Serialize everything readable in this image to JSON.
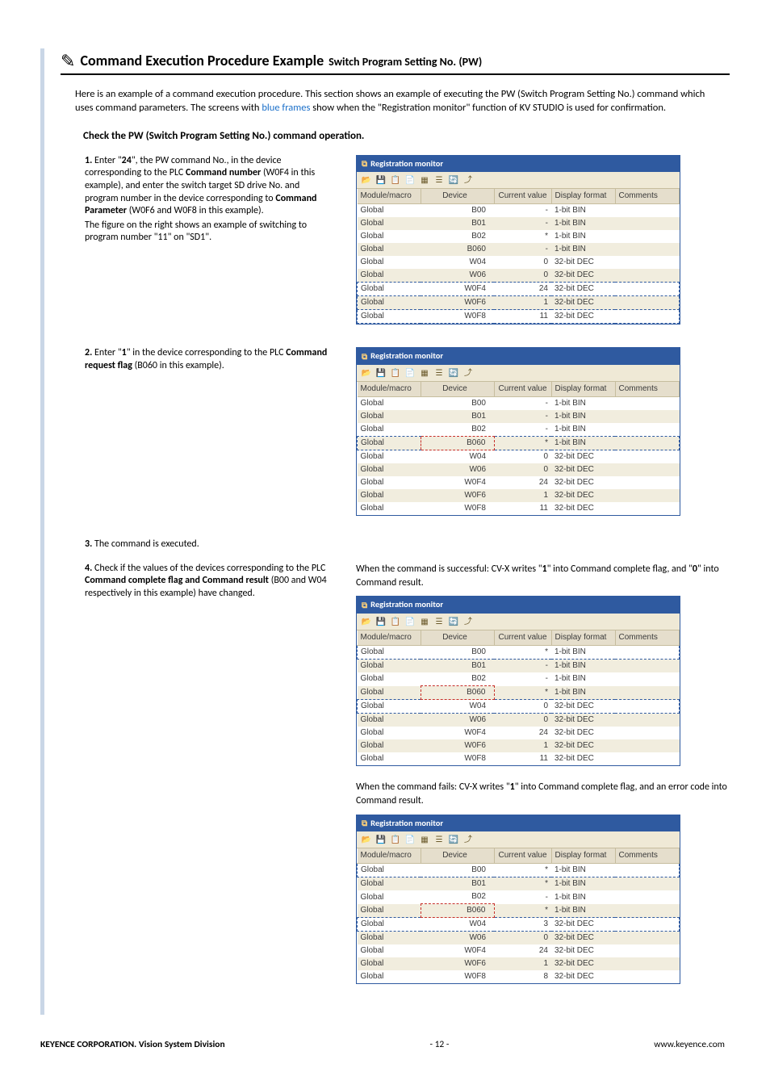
{
  "header": {
    "title_main": "Command Execution Procedure Example",
    "title_sub": "Switch Program Setting No. (PW)"
  },
  "intro_parts": {
    "p1": "Here is an example of a command execution procedure. This section shows an example of executing the PW (Switch Program Setting No.) command which uses command parameters. The screens with ",
    "blue": "blue frames",
    "p2": " show when the \"Registration monitor\" function of KV STUDIO is used for confirmation."
  },
  "section_title": "Check the PW (Switch Program Setting No.) command operation.",
  "steps": {
    "s1_a": "1.",
    "s1_b": " Enter \"",
    "s1_c": "24",
    "s1_d": "\", the PW command No., in the device corresponding to the PLC ",
    "s1_e": "Command number",
    "s1_f": " (W0F4 in this example), and enter the switch target SD drive No. and program number in the device corresponding to ",
    "s1_g": "Command Parameter",
    "s1_h": " (W0F6 and W0F8 in this example).",
    "s1_i": "The figure on the right shows an example of switching to program number \"11\" on \"SD1\".",
    "s2_a": "2.",
    "s2_b": " Enter \"",
    "s2_c": "1",
    "s2_d": "\" in the device corresponding to the PLC ",
    "s2_e": "Command request flag",
    "s2_f": " (B060 in this example).",
    "s3_a": "3.",
    "s3_b": " The command is executed.",
    "s4_a": "4.",
    "s4_b": " Check if the values of the devices corresponding to the PLC ",
    "s4_c": "Command complete flag and Command result",
    "s4_d": " (B00 and W04 respectively in this example) have changed."
  },
  "regmon": {
    "title": "Registration monitor",
    "headers": {
      "mod": "Module/macro",
      "dev": "Device",
      "cur": "Current value",
      "fmt": "Display format",
      "com": "Comments"
    }
  },
  "chart_data": [
    {
      "type": "table",
      "title": "Registration monitor (step 1)",
      "columns": [
        "Module/macro",
        "Device",
        "Current value",
        "Display format",
        "Comments"
      ],
      "rows": [
        [
          "Global",
          "B00",
          "-",
          "1-bit BIN",
          ""
        ],
        [
          "Global",
          "B01",
          "-",
          "1-bit BIN",
          ""
        ],
        [
          "Global",
          "B02",
          "*",
          "1-bit BIN",
          ""
        ],
        [
          "Global",
          "B060",
          "-",
          "1-bit BIN",
          ""
        ],
        [
          "Global",
          "W04",
          "0",
          "32-bit DEC",
          ""
        ],
        [
          "Global",
          "W06",
          "0",
          "32-bit DEC",
          ""
        ],
        [
          "Global",
          "W0F4",
          "24",
          "32-bit DEC",
          ""
        ],
        [
          "Global",
          "W0F6",
          "1",
          "32-bit DEC",
          ""
        ],
        [
          "Global",
          "W0F8",
          "11",
          "32-bit DEC",
          ""
        ]
      ],
      "highlight_rows_blue": [
        6,
        7,
        8
      ]
    },
    {
      "type": "table",
      "title": "Registration monitor (step 2)",
      "columns": [
        "Module/macro",
        "Device",
        "Current value",
        "Display format",
        "Comments"
      ],
      "rows": [
        [
          "Global",
          "B00",
          "-",
          "1-bit BIN",
          ""
        ],
        [
          "Global",
          "B01",
          "-",
          "1-bit BIN",
          ""
        ],
        [
          "Global",
          "B02",
          "-",
          "1-bit BIN",
          ""
        ],
        [
          "Global",
          "B060",
          "*",
          "1-bit BIN",
          ""
        ],
        [
          "Global",
          "W04",
          "0",
          "32-bit DEC",
          ""
        ],
        [
          "Global",
          "W06",
          "0",
          "32-bit DEC",
          ""
        ],
        [
          "Global",
          "W0F4",
          "24",
          "32-bit DEC",
          ""
        ],
        [
          "Global",
          "W0F6",
          "1",
          "32-bit DEC",
          ""
        ],
        [
          "Global",
          "W0F8",
          "11",
          "32-bit DEC",
          ""
        ]
      ],
      "red_device_cells": [
        3
      ],
      "highlight_rows_blue": [
        3
      ]
    },
    {
      "type": "table",
      "title": "Registration monitor (step 4 success)",
      "columns": [
        "Module/macro",
        "Device",
        "Current value",
        "Display format",
        "Comments"
      ],
      "rows": [
        [
          "Global",
          "B00",
          "*",
          "1-bit BIN",
          ""
        ],
        [
          "Global",
          "B01",
          "-",
          "1-bit BIN",
          ""
        ],
        [
          "Global",
          "B02",
          "-",
          "1-bit BIN",
          ""
        ],
        [
          "Global",
          "B060",
          "*",
          "1-bit BIN",
          ""
        ],
        [
          "Global",
          "W04",
          "0",
          "32-bit DEC",
          ""
        ],
        [
          "Global",
          "W06",
          "0",
          "32-bit DEC",
          ""
        ],
        [
          "Global",
          "W0F4",
          "24",
          "32-bit DEC",
          ""
        ],
        [
          "Global",
          "W0F6",
          "1",
          "32-bit DEC",
          ""
        ],
        [
          "Global",
          "W0F8",
          "11",
          "32-bit DEC",
          ""
        ]
      ],
      "red_device_cells": [
        3
      ],
      "highlight_rows_blue": [
        0,
        4
      ]
    },
    {
      "type": "table",
      "title": "Registration monitor (step 4 fail)",
      "columns": [
        "Module/macro",
        "Device",
        "Current value",
        "Display format",
        "Comments"
      ],
      "rows": [
        [
          "Global",
          "B00",
          "*",
          "1-bit BIN",
          ""
        ],
        [
          "Global",
          "B01",
          "*",
          "1-bit BIN",
          ""
        ],
        [
          "Global",
          "B02",
          "-",
          "1-bit BIN",
          ""
        ],
        [
          "Global",
          "B060",
          "*",
          "1-bit BIN",
          ""
        ],
        [
          "Global",
          "W04",
          "3",
          "32-bit DEC",
          ""
        ],
        [
          "Global",
          "W06",
          "0",
          "32-bit DEC",
          ""
        ],
        [
          "Global",
          "W0F4",
          "24",
          "32-bit DEC",
          ""
        ],
        [
          "Global",
          "W0F6",
          "1",
          "32-bit DEC",
          ""
        ],
        [
          "Global",
          "W0F8",
          "8",
          "32-bit DEC",
          ""
        ]
      ],
      "red_device_cells": [
        3
      ],
      "highlight_rows_blue": [
        0,
        4
      ]
    }
  ],
  "result_text": {
    "success_a": "When the command is successful: CV-X writes \"",
    "success_b": "1",
    "success_c": "\" into Command complete flag, and \"",
    "success_d": "0",
    "success_e": "\" into Command result.",
    "fail_a": "When the command fails: CV-X writes \"",
    "fail_b": "1",
    "fail_c": "\" into Command complete flag, and an error code into Command result."
  },
  "footer": {
    "left": "KEYENCE CORPORATION. Vision System Division",
    "center": "- 12 -",
    "right": "www.keyence.com"
  }
}
